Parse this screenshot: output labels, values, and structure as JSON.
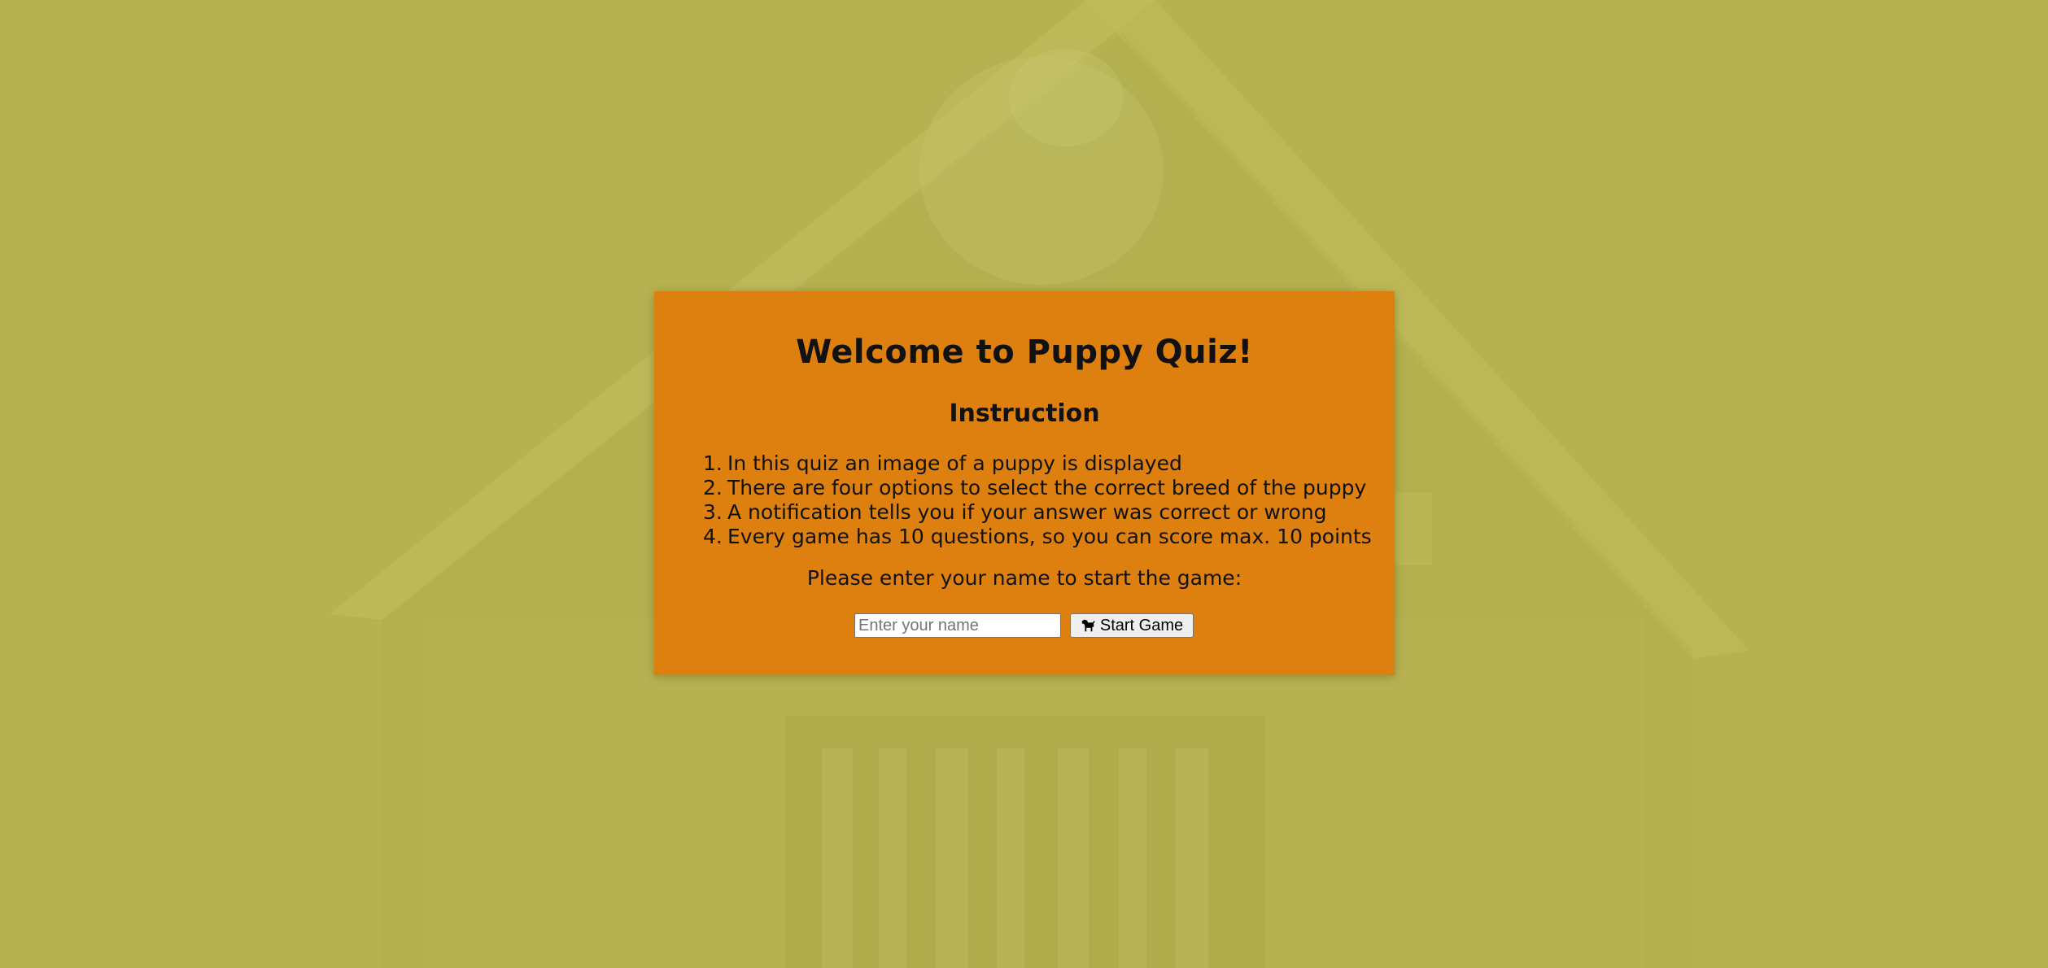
{
  "colors": {
    "background": "#b6b251",
    "card": "#dd800f",
    "button": "#efefef"
  },
  "card": {
    "title": "Welcome to Puppy Quiz!",
    "instruction_heading": "Instruction",
    "instructions": [
      {
        "number": "1.",
        "text": "In this quiz an image of a puppy is displayed"
      },
      {
        "number": "2.",
        "text": "There are four options to select the correct breed of the puppy"
      },
      {
        "number": "3.",
        "text": "A notification tells you if your answer was correct or wrong"
      },
      {
        "number": "4.",
        "text": "Every game has 10 questions, so you can score max. 10 points"
      }
    ],
    "prompt": "Please enter your name to start the game:",
    "name_input": {
      "value": "",
      "placeholder": "Enter your name"
    },
    "start_button": {
      "icon": "dog-icon",
      "label": "Start Game"
    }
  }
}
